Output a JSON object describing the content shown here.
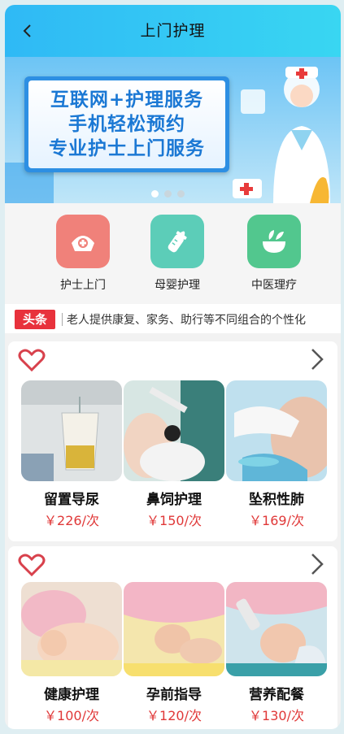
{
  "header": {
    "title": "上门护理"
  },
  "banner": {
    "lines": [
      "互联网+护理服务",
      "手机轻松预约",
      "专业护士上门服务"
    ],
    "dot_count": 3,
    "active_dot": 0
  },
  "quick_links": [
    {
      "label": "护士上门",
      "icon": "nurse-cap-icon",
      "color": "#f0817a"
    },
    {
      "label": "母婴护理",
      "icon": "baby-bottle-icon",
      "color": "#5ccdb8"
    },
    {
      "label": "中医理疗",
      "icon": "herbal-bowl-icon",
      "color": "#52c78e"
    }
  ],
  "headline": {
    "tag": "头条",
    "text": "老人提供康复、家务、助行等不同组合的个性化"
  },
  "sections": [
    {
      "services": [
        {
          "name": "留置导尿",
          "price": "￥226/次"
        },
        {
          "name": "鼻饲护理",
          "price": "￥150/次"
        },
        {
          "name": "坠积性肺",
          "price": "￥169/次"
        }
      ]
    },
    {
      "services": [
        {
          "name": "健康护理",
          "price": "￥100/次"
        },
        {
          "name": "孕前指导",
          "price": "￥120/次"
        },
        {
          "name": "营养配餐",
          "price": "￥130/次"
        }
      ]
    }
  ],
  "colors": {
    "header_start": "#2fb9f5",
    "header_end": "#39d6f2",
    "price": "#e03838",
    "headline_tag": "#e8323c",
    "heart": "#d8414c"
  }
}
